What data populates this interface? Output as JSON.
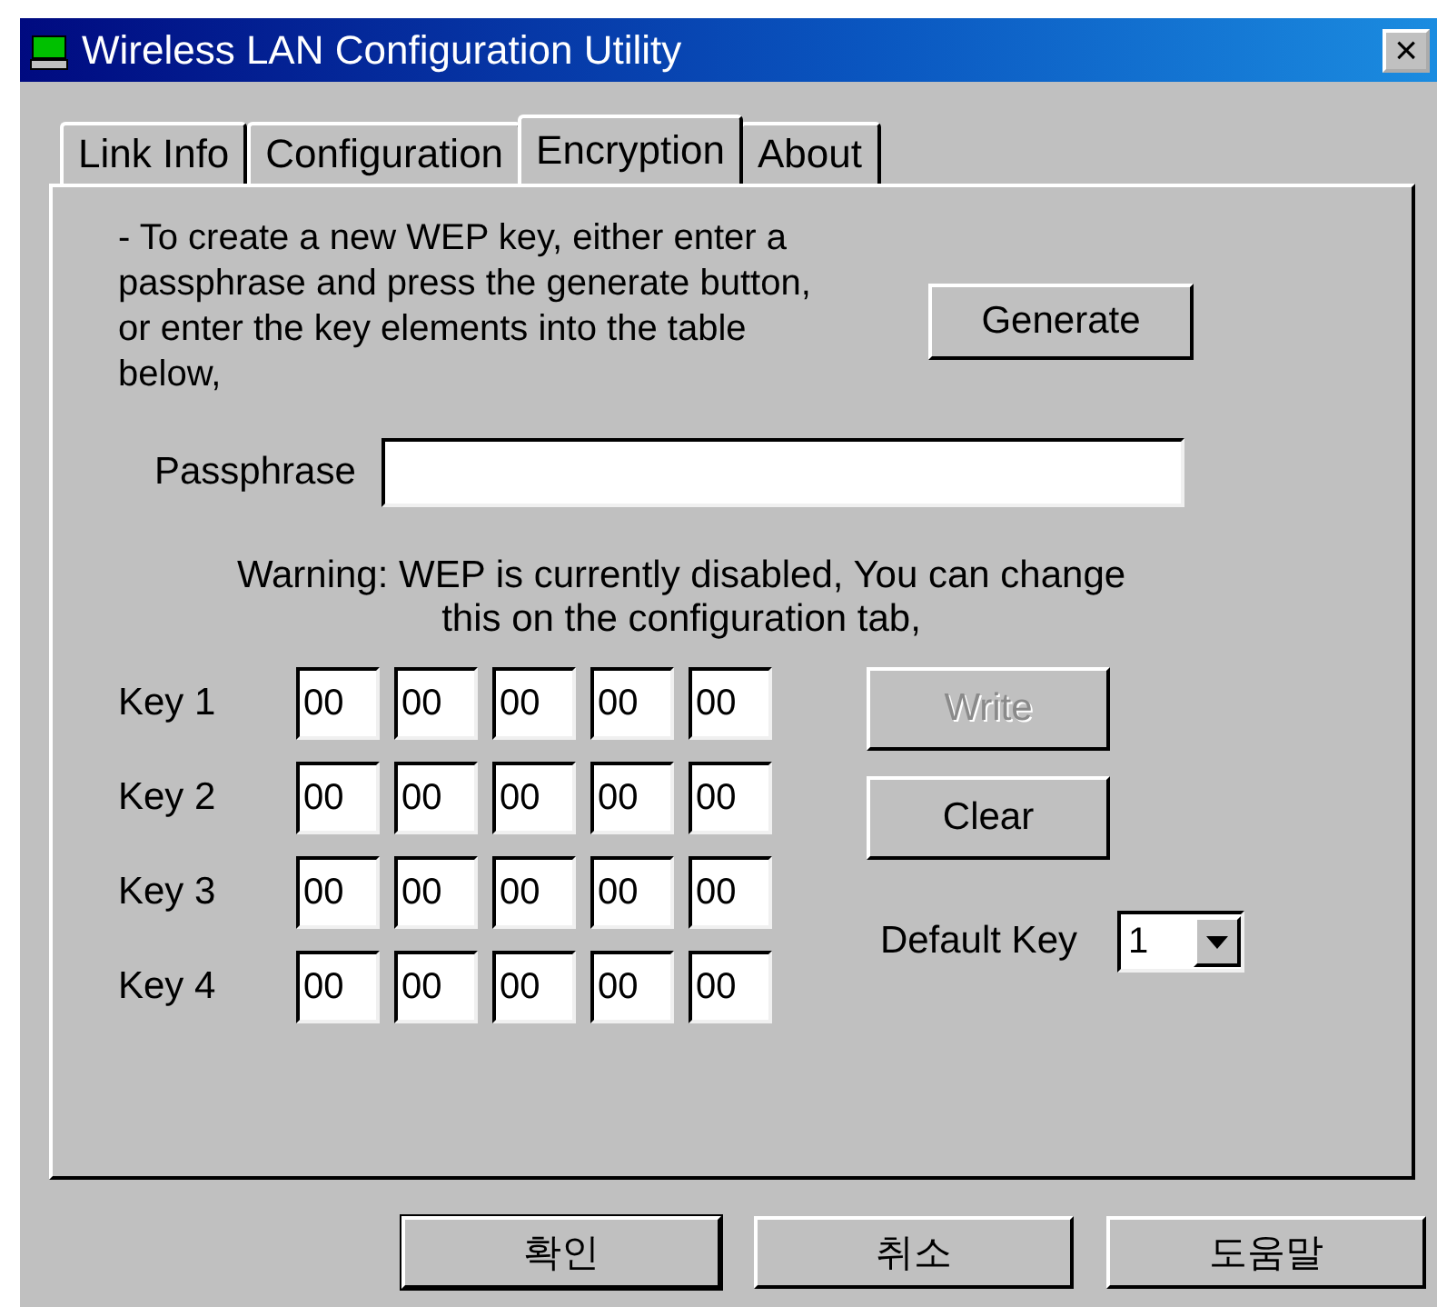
{
  "window": {
    "title": "Wireless LAN Configuration Utility",
    "close": "×"
  },
  "tabs": [
    {
      "label": "Link Info",
      "selected": false
    },
    {
      "label": "Configuration",
      "selected": false
    },
    {
      "label": "Encryption",
      "selected": true
    },
    {
      "label": "About",
      "selected": false
    }
  ],
  "instructions": "- To create a new WEP key, either enter a passphrase and press the generate button, or enter the key elements into the table below,",
  "generate_button": {
    "label": "Generate",
    "disabled": false
  },
  "passphrase": {
    "label": "Passphrase"
  },
  "warning": [
    "Warning: WEP is currently disabled,  You can change",
    "this on the configuration tab,"
  ],
  "keys": [
    {
      "label": "Key 1",
      "bytes": [
        "00",
        "00",
        "00",
        "00",
        "00"
      ]
    },
    {
      "label": "Key 2",
      "bytes": [
        "00",
        "00",
        "00",
        "00",
        "00"
      ]
    },
    {
      "label": "Key 3",
      "bytes": [
        "00",
        "00",
        "00",
        "00",
        "00"
      ]
    },
    {
      "label": "Key 4",
      "bytes": [
        "00",
        "00",
        "00",
        "00",
        "00"
      ]
    }
  ],
  "write_button": {
    "label": "Write",
    "disabled": true
  },
  "clear_button": {
    "label": "Clear",
    "disabled": false
  },
  "default_key": {
    "label": "Default Key",
    "value": "1"
  },
  "footer_buttons": [
    {
      "label": "확인",
      "default": true
    },
    {
      "label": "취소",
      "default": false
    },
    {
      "label": "도움말",
      "default": false
    }
  ]
}
